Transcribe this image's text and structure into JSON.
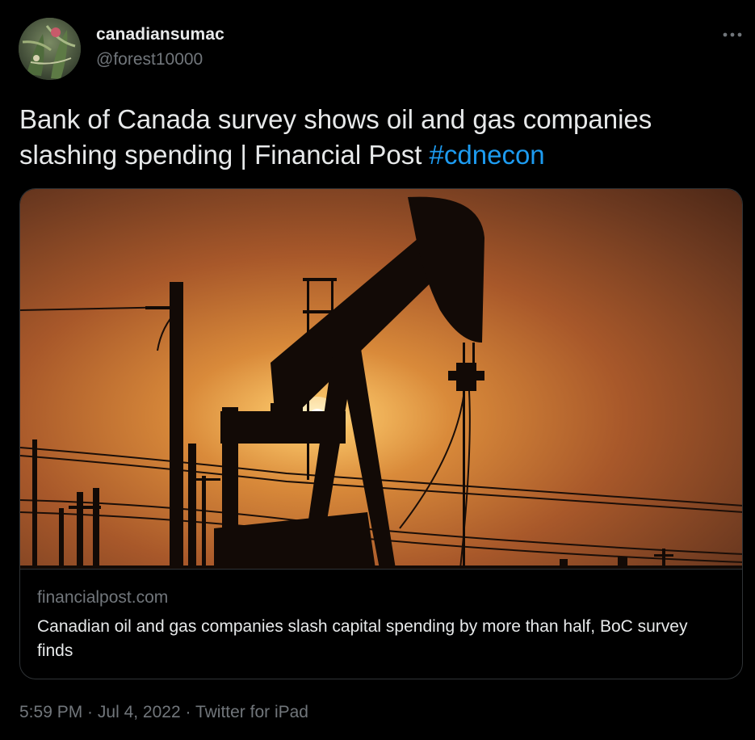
{
  "author": {
    "display_name": "canadiansumac",
    "handle": "@forest10000"
  },
  "tweet": {
    "text": "Bank of Canada survey shows oil and gas companies slashing spending | Financial Post ",
    "hashtag": "#cdnecon"
  },
  "card": {
    "domain": "financialpost.com",
    "title": "Canadian oil and gas companies slash capital spending by more than half, BoC survey finds"
  },
  "meta": {
    "time": "5:59 PM",
    "separator": " · ",
    "date": "Jul 4, 2022",
    "source": "Twitter for iPad"
  },
  "icons": {
    "more": "more-horizontal-icon"
  },
  "colors": {
    "background": "#000000",
    "text": "#e7e9ea",
    "secondary": "#71767b",
    "link": "#1d9bf0",
    "border": "#2f3336"
  }
}
